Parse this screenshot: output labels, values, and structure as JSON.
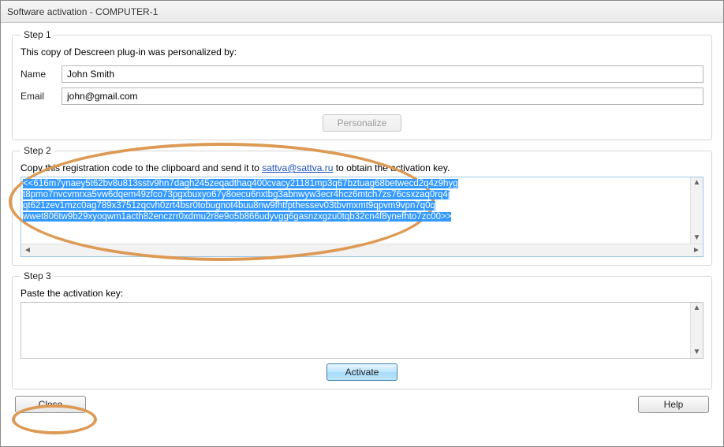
{
  "window": {
    "title": "Software activation - COMPUTER-1"
  },
  "step1": {
    "legend": "Step 1",
    "intro": "This copy of Descreen plug-in was personalized by:",
    "name_label": "Name",
    "name_value": "John Smith",
    "email_label": "Email",
    "email_value": "john@gmail.com",
    "personalize_btn": "Personalize"
  },
  "step2": {
    "legend": "Step 2",
    "instr_prefix": "Copy this registration code to the clipboard and send it to ",
    "instr_link_text": "sattva@sattva.ru",
    "instr_suffix": " to obtain the activation key.",
    "code_lines": [
      "<<616m7ynaey5t62bv8u813sstv9hn7dagh245zeqadthaq400cvacy21181mp3q67bztuag68betwecd2q4z9hyg",
      "t8pmo7nvcvmrxa5vw6dqem49zfco73pgxbuxyo67y8oecu6nxtbg3abnwyw3ecr4hcz6mtch7zs76csxzaq0rq4j",
      "qt621zev1mzc0ag789x3751zqcvh0zrt4bsr0tobugnot4buu8nw9fhtfpthessev03tbvmxmt9qpvm9vpn7q0q",
      "wwet806tw9b29xyoqwm1acth82enczrr0xdmu2r8e9o5b866udyvgg6gasnzxgzu0tqb32cn4f8ynefhto7zc00>>"
    ]
  },
  "step3": {
    "legend": "Step 3",
    "instr": "Paste the activation key:",
    "activate_btn": "Activate"
  },
  "buttons": {
    "close": "Close",
    "help": "Help"
  }
}
